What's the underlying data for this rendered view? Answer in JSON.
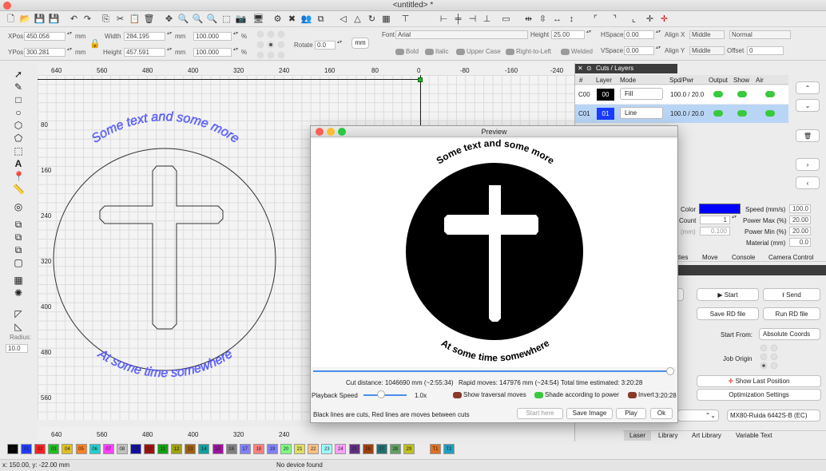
{
  "window": {
    "title": "<untitled> *"
  },
  "props": {
    "xpos_label": "XPos",
    "xpos": "450.056",
    "ypos_label": "YPos",
    "ypos": "300.281",
    "unit": "mm",
    "width_label": "Width",
    "width": "284.195",
    "height_label": "Height",
    "height": "457.591",
    "scale_w": "100.000",
    "scale_h": "100.000",
    "pct": "%",
    "rotate_label": "Rotate",
    "rotate": "0.0",
    "mm_button": "mm",
    "font_label": "Font",
    "font": "Arial",
    "fheight_label": "Height",
    "fheight": "25.00",
    "hspace_label": "HSpace",
    "hspace": "0.00",
    "vspace_label": "VSpace",
    "vspace": "0.00",
    "alignx_label": "Align X",
    "alignx": "Middle",
    "aligny_label": "Align Y",
    "aligny": "Middle",
    "style": "Normal",
    "offset_label": "Offset",
    "offset": "0",
    "bold": "Bold",
    "italic": "Italic",
    "upper": "Upper Case",
    "rtl": "Right-to-Left",
    "welded": "Welded"
  },
  "tools": {
    "radius_label": "Radius:",
    "radius": "10.0"
  },
  "ruler": {
    "top": [
      "640",
      "560",
      "480",
      "400",
      "320",
      "240",
      "160",
      "80",
      "0",
      "-80",
      "-160",
      "-240"
    ],
    "left": [
      "80",
      "160",
      "240",
      "320",
      "400",
      "480",
      "560"
    ]
  },
  "canvas": {
    "text_top": "Some text and some more",
    "text_bottom": "At some time somewhere"
  },
  "cuts": {
    "title": "Cuts / Layers",
    "headers": [
      "#",
      "Layer",
      "Mode",
      "Spd/Pwr",
      "Output",
      "Show",
      "Air"
    ],
    "rows": [
      {
        "id": "C00",
        "layer": "00",
        "mode": "Fill",
        "spd": "100.0 / 20.0",
        "color": "#000000"
      },
      {
        "id": "C01",
        "layer": "01",
        "mode": "Line",
        "spd": "100.0 / 20.0",
        "color": "#1a3cff"
      }
    ]
  },
  "layerprops": {
    "color_label": "Color",
    "count_label": "Count",
    "count": "1",
    "mm_label": "(mm)",
    "mm_val": "0.100",
    "speed_label": "Speed (mm/s)",
    "speed": "100.0",
    "pmax_label": "Power Max (%)",
    "pmax": "20.00",
    "pmin_label": "Power Min (%)",
    "pmin": "20.00",
    "material_label": "Material (mm)",
    "material": "0.0"
  },
  "tabs1": [
    "ties",
    "Move",
    "Console",
    "Camera Control"
  ],
  "laser": {
    "start": "Start",
    "send": "Send",
    "save_rd": "Save RD file",
    "run_rd": "Run RD file",
    "start_from_label": "Start From:",
    "start_from": "Absolute Coords",
    "job_origin_label": "Job Origin",
    "show_last": "Show Last Position",
    "optimization": "Optimization Settings",
    "device": "MX80-Ruida 6442S-B (EC)"
  },
  "tabs2": [
    "Laser",
    "Library",
    "Art Library",
    "Variable Text"
  ],
  "preview": {
    "title": "Preview",
    "cut_distance": "Cut distance: 1046690 mm (~2:55:34)",
    "rapid": "Rapid moves: 147976 mm (~24:54)",
    "total": "Total time estimated: 3:20:28",
    "playback_label": "Playback Speed",
    "playback": "1.0x",
    "show_traversal": "Show traversal moves",
    "shade": "Shade according to power",
    "invert": "Invert",
    "invert_time": "3:20:28",
    "note": "Black lines are cuts, Red lines are moves between cuts",
    "start_here": "Start here",
    "save_image": "Save Image",
    "play": "Play",
    "ok": "Ok",
    "text_top": "Some text and some more",
    "text_bottom": "At some time somewhere"
  },
  "palette": [
    "00",
    "01",
    "02",
    "03",
    "04",
    "05",
    "06",
    "07",
    "08",
    "09",
    "10",
    "11",
    "12",
    "13",
    "14",
    "15",
    "16",
    "17",
    "18",
    "19",
    "20",
    "21",
    "22",
    "23",
    "24",
    "25",
    "26",
    "27",
    "28",
    "29",
    "T1",
    "T2"
  ],
  "palette_colors": [
    "#000000",
    "#1f3cff",
    "#ff2020",
    "#20c020",
    "#e0c020",
    "#ff8020",
    "#20d0d0",
    "#ff40ff",
    "#c0c0c0",
    "#1010a0",
    "#a01010",
    "#10a010",
    "#a0a010",
    "#a06010",
    "#10a0a0",
    "#a010a0",
    "#808080",
    "#8080ff",
    "#ff8080",
    "#8080ff",
    "#80ff80",
    "#e0e060",
    "#ffc080",
    "#a0ffff",
    "#ffa0ff",
    "#603080",
    "#a04010",
    "#207070",
    "#60a060",
    "#c0c020",
    "#e07020",
    "#20a0c0"
  ],
  "status": {
    "coords": "x: 150.00, y: -22.00 mm",
    "device": "No device found"
  }
}
